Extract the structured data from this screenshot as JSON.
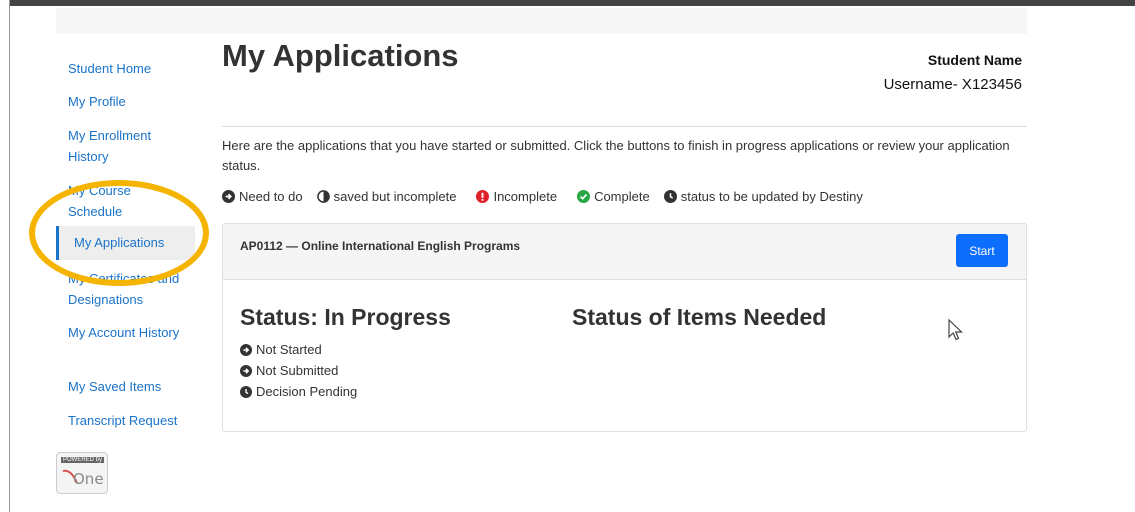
{
  "sidebar": {
    "items": [
      {
        "label": "Student Home"
      },
      {
        "label": "My Profile"
      },
      {
        "label": "My Enrollment History"
      },
      {
        "label": "My Course Schedule"
      },
      {
        "label": "My Applications",
        "active": true
      },
      {
        "label": "My Certificates and Designations"
      },
      {
        "label": "My Account History"
      },
      {
        "label": "My Saved Items"
      },
      {
        "label": "Transcript Request"
      }
    ],
    "powered_by": {
      "badge": "POWERED by",
      "brand": "One"
    }
  },
  "header": {
    "title": "My Applications",
    "student_name": "Student Name",
    "username": "Username- X123456"
  },
  "intro_text": "Here are the applications that you have started or submitted. Click the buttons to finish in progress applications or review your application status.",
  "legend": [
    {
      "icon": "arrow-circle-right-icon",
      "label": "Need to do",
      "color": "#333333"
    },
    {
      "icon": "half-circle-icon",
      "label": "saved but incomplete",
      "color": "#333333"
    },
    {
      "icon": "exclamation-circle-icon",
      "label": "Incomplete",
      "color": "#e0202a"
    },
    {
      "icon": "check-circle-icon",
      "label": "Complete",
      "color": "#28a745"
    },
    {
      "icon": "clock-icon",
      "label": "status to be updated by Destiny",
      "color": "#333333"
    }
  ],
  "application": {
    "code_title": "AP0112 — Online International English Programs",
    "start_label": "Start",
    "status_heading": "Status: In Progress",
    "items_heading": "Status of Items Needed",
    "status_items": [
      {
        "icon": "arrow-circle-right-icon",
        "label": "Not Started"
      },
      {
        "icon": "arrow-circle-right-icon",
        "label": "Not Submitted"
      },
      {
        "icon": "clock-icon",
        "label": "Decision Pending"
      }
    ]
  },
  "colors": {
    "accent": "#1a73c9",
    "button": "#0d6efd",
    "highlight": "#f4b400"
  }
}
